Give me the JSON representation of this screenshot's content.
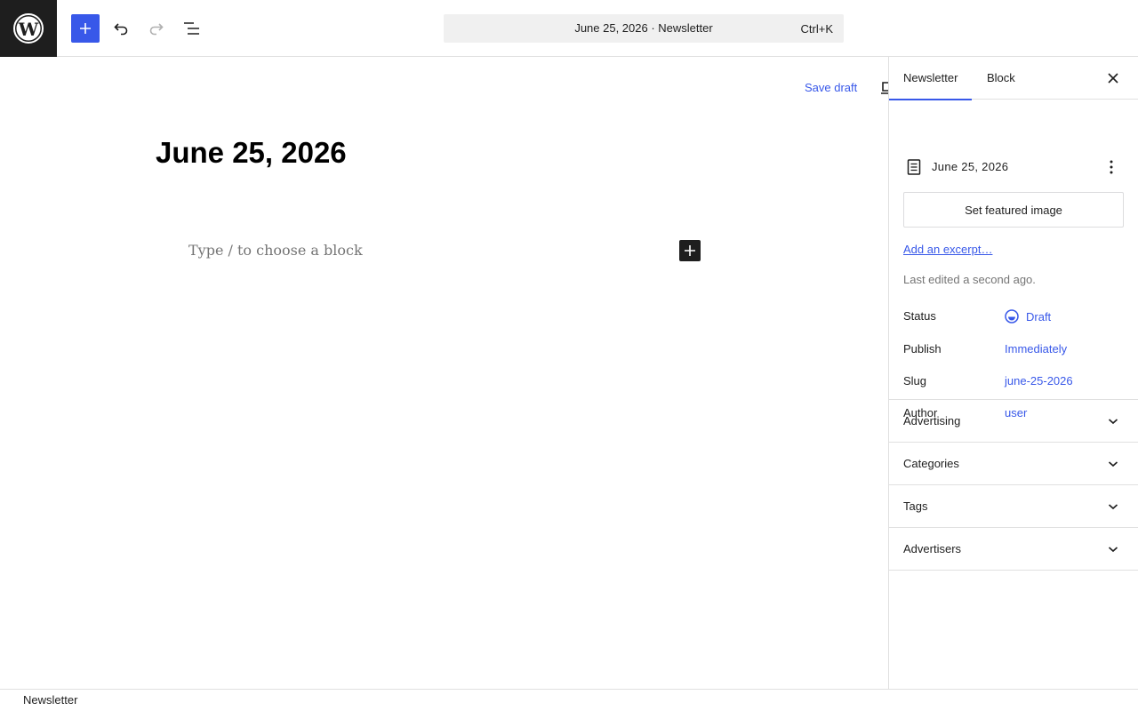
{
  "topbar": {
    "logo_icon": "wordpress-logo-icon",
    "inserter_icon": "plus-icon",
    "undo_icon": "undo-icon",
    "redo_icon": "redo-icon",
    "outline_icon": "document-overview-icon",
    "command_bar": {
      "title": "June 25, 2026 · Newsletter",
      "shortcut": "Ctrl+K"
    }
  },
  "canvas": {
    "save_draft_label": "Save draft",
    "preview_icon": "desktop-preview-icon",
    "post_title": "June 25, 2026",
    "block_placeholder": "Type / to choose a block",
    "block_inserter_icon": "plus-icon"
  },
  "sidebar": {
    "tabs": [
      {
        "label": "Newsletter",
        "active": true
      },
      {
        "label": "Block",
        "active": false
      }
    ],
    "close_icon": "close-icon",
    "document": {
      "icon": "post-document-icon",
      "title": "June 25, 2026",
      "more_icon": "more-vertical-icon",
      "featured_image_label": "Set featured image",
      "excerpt_link": "Add an excerpt…",
      "last_edited": "Last edited a second ago."
    },
    "meta": [
      {
        "label": "Status",
        "value": "Draft",
        "icon": "draft-status-icon"
      },
      {
        "label": "Publish",
        "value": "Immediately"
      },
      {
        "label": "Slug",
        "value": "june-25-2026"
      },
      {
        "label": "Author",
        "value": "user"
      }
    ],
    "panels": [
      {
        "title": "Advertising",
        "icon": "chevron-down-icon"
      },
      {
        "title": "Categories",
        "icon": "chevron-down-icon"
      },
      {
        "title": "Tags",
        "icon": "chevron-down-icon"
      },
      {
        "title": "Advertisers",
        "icon": "chevron-down-icon"
      }
    ]
  },
  "footer": {
    "breadcrumb": "Newsletter"
  },
  "colors": {
    "accent": "#3858e9",
    "dark": "#1e1e1e",
    "muted": "#757575",
    "border": "#e0e0e0"
  }
}
